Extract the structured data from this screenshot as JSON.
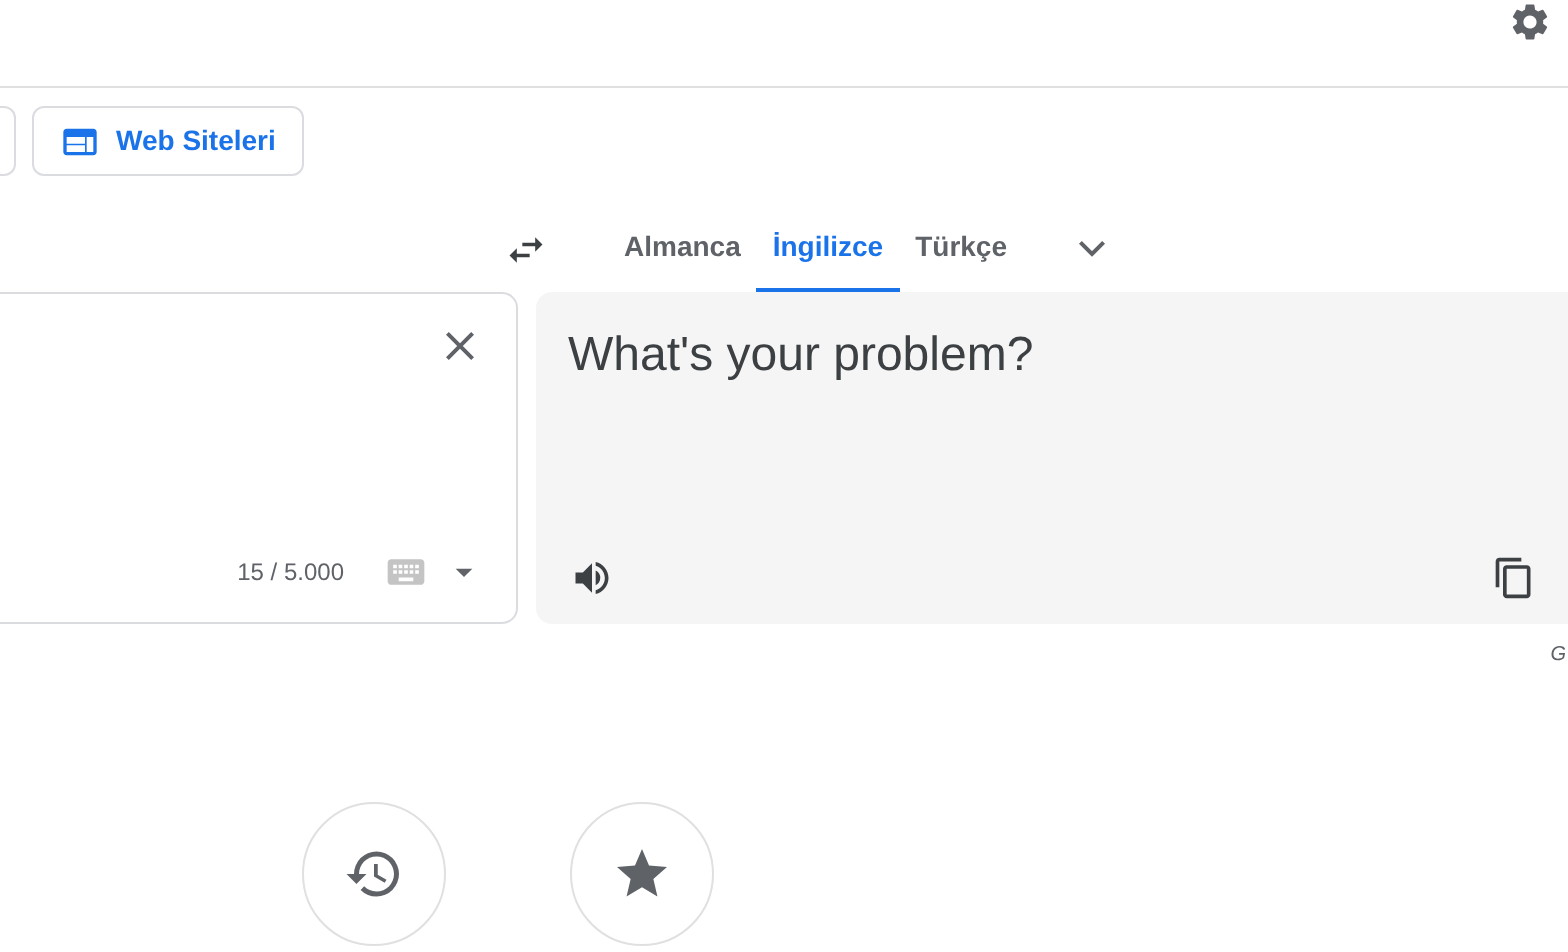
{
  "mode_buttons": [
    {
      "label": "Web Siteleri"
    }
  ],
  "target_languages": [
    {
      "label": "Almanca",
      "selected": false
    },
    {
      "label": "İngilizce",
      "selected": true
    },
    {
      "label": "Türkçe",
      "selected": false
    }
  ],
  "source": {
    "char_count": "15 / 5.000"
  },
  "translation": {
    "text": "What's your problem?"
  },
  "attribution": "G"
}
